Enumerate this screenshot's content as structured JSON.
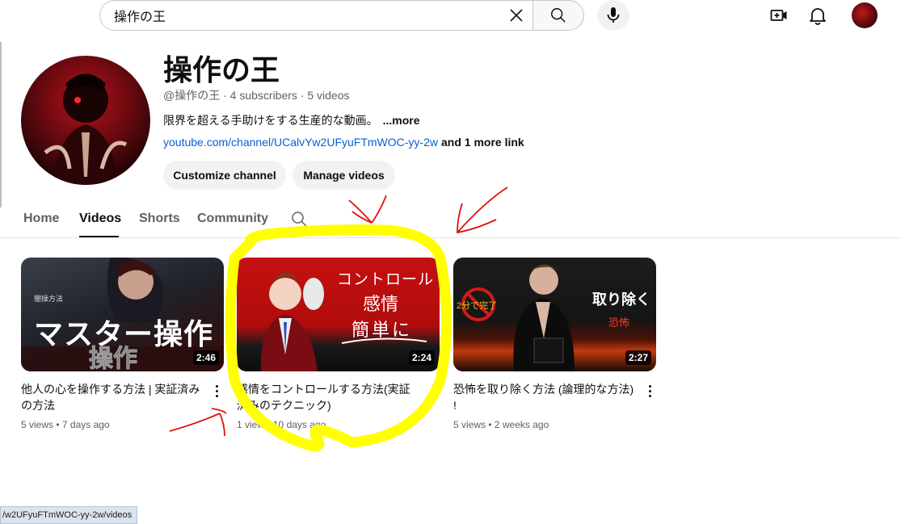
{
  "header": {
    "search": {
      "value": "操作の王"
    },
    "icons": [
      "close-icon",
      "search-icon",
      "mic-icon",
      "create-icon",
      "bell-icon",
      "avatar"
    ]
  },
  "channel": {
    "name": "操作の王",
    "meta": "@操作の王 · 4 subscribers · 5 videos",
    "description": "限界を超える手助けをする生産的な動画。",
    "more": "...more",
    "link_url": "youtube.com/channel/UCalvYw2UFyuFTmWOC-yy-2w",
    "link_more": "and 1 more link",
    "customize_label": "Customize channel",
    "manage_label": "Manage videos"
  },
  "tabs": [
    {
      "label": "Home"
    },
    {
      "label": "Videos"
    },
    {
      "label": "Shorts"
    },
    {
      "label": "Community"
    }
  ],
  "videos": [
    {
      "thumb_text": "マスター操作",
      "thumb_sub": "操作",
      "thumb_tag": "闇操方法",
      "duration": "2:46",
      "title": "他人の心を操作する方法 | 実証済みの方法",
      "meta": "5 views • 7 days ago"
    },
    {
      "thumb_line1": "コントロール",
      "thumb_line2": "感情",
      "thumb_line3": "簡単に",
      "duration": "2:24",
      "title": "感情をコントロールする方法(実証済みのテクニック)",
      "meta": "1 view • 10 days ago"
    },
    {
      "thumb_line1": "取り除く",
      "thumb_line2": "恐怖",
      "thumb_badge": "2分で完了",
      "duration": "2:27",
      "title": "恐怖を取り除く方法 (論理的な方法) !",
      "meta": "5 views • 2 weeks ago"
    }
  ],
  "status_bar": {
    "url": "/w2UFyuFTmWOC-yy-2w/videos"
  },
  "colors": {
    "link": "#065fd4",
    "annotation_yellow": "#ffff00",
    "annotation_red": "#e01010"
  }
}
